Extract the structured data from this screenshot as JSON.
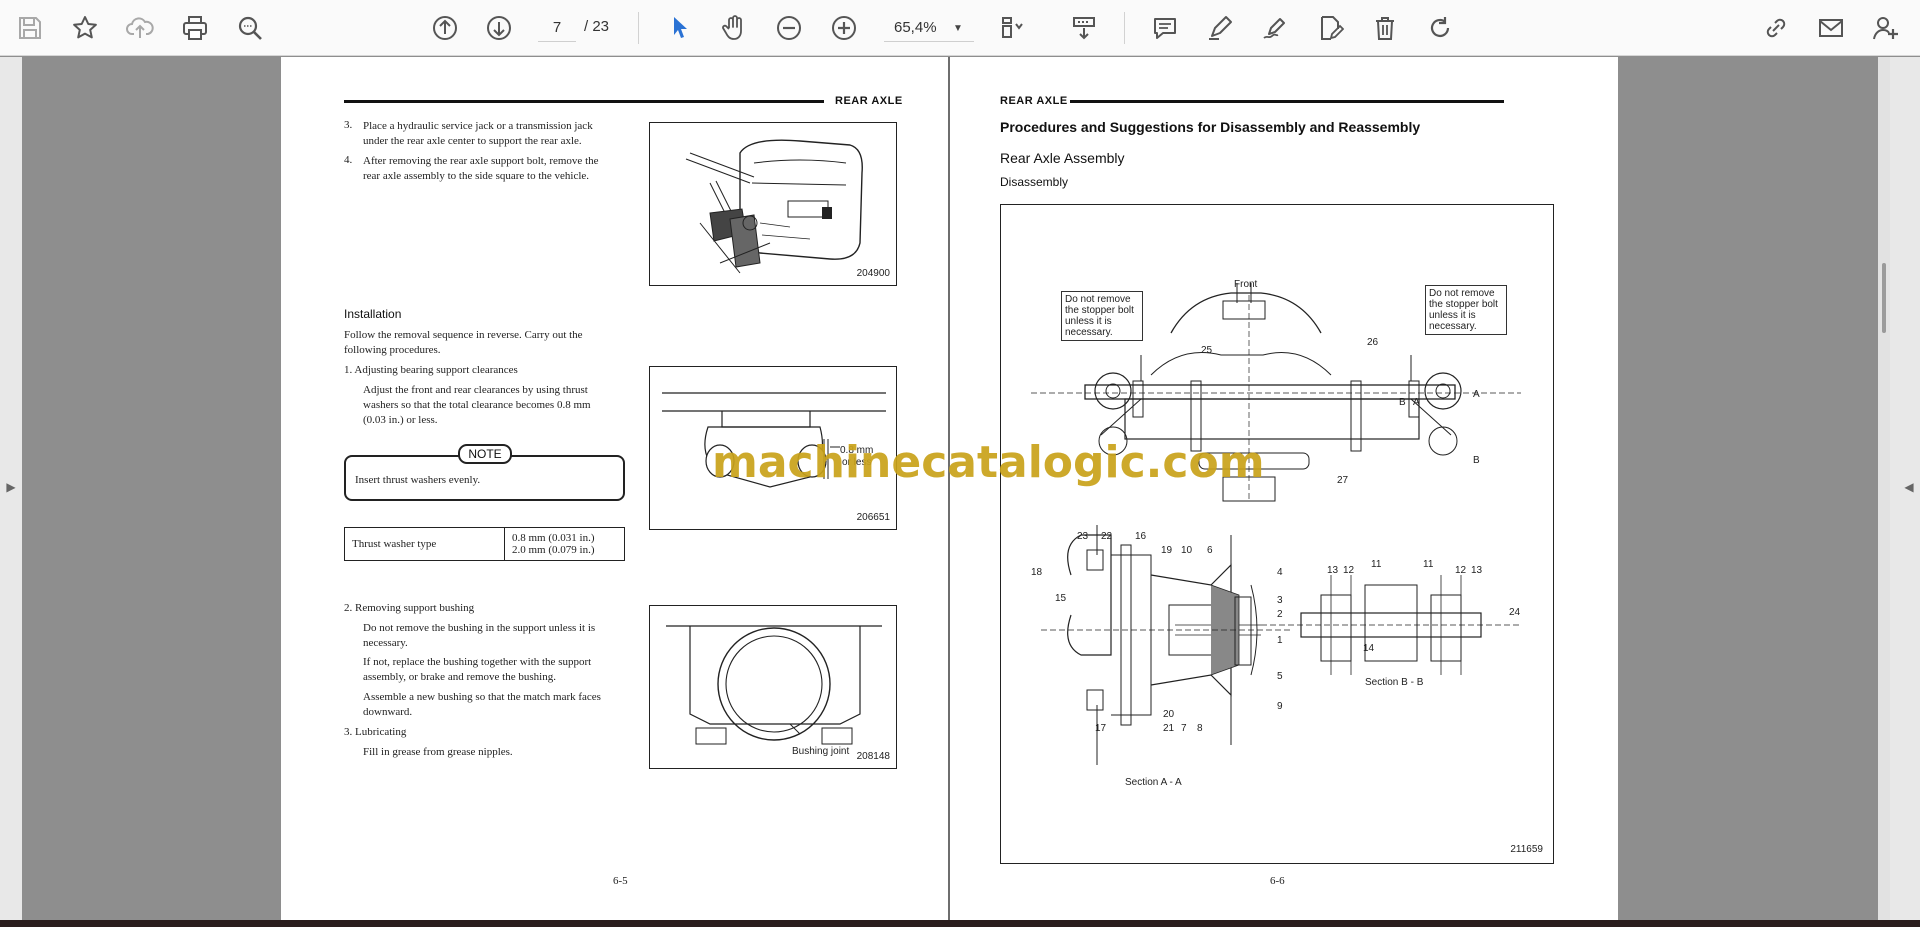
{
  "toolbar": {
    "current_page": "7",
    "page_total": "/ 23",
    "zoom": "65,4%"
  },
  "left_page": {
    "header": "REAR AXLE",
    "steps_top": [
      {
        "num": "3.",
        "lines": [
          "Place a hydraulic service jack or a transmission jack",
          "under the rear axle center to support the rear axle."
        ]
      },
      {
        "num": "4.",
        "lines": [
          "After removing the rear axle support bolt, remove the",
          "rear axle assembly to the side square to the vehicle."
        ]
      }
    ],
    "fig1_number": "204900",
    "install_heading": "Installation",
    "install_intro": [
      "Follow the removal sequence in reverse.  Carry out the",
      "following procedures."
    ],
    "step1_title": "1.   Adjusting bearing support clearances",
    "step1_body": [
      "Adjust the front and rear clearances by using thrust",
      "washers so that the total clearance becomes 0.8 mm",
      "(0.03 in.) or less."
    ],
    "note_label": "NOTE",
    "note_text": "Insert thrust washers evenly.",
    "table": {
      "label": "Thrust washer type",
      "values": [
        "0.8 mm (0.031 in.)",
        "2.0 mm (0.079 in.)"
      ]
    },
    "fig2_number": "206651",
    "fig2_label_a": "0.8 mm",
    "fig2_label_b": "or less",
    "step2_title": "2.   Removing support bushing",
    "step2_body": [
      [
        "Do not remove the bushing in the support unless it is",
        "necessary."
      ],
      [
        "If not, replace the bushing together with the support",
        "assembly, or brake and remove the bushing."
      ],
      [
        "Assemble a new bushing so that the match mark faces",
        "downward."
      ]
    ],
    "step3_title": "3.   Lubricating",
    "step3_body": "Fill in grease from grease nipples.",
    "fig3_number": "208148",
    "fig3_label": "Bushing joint",
    "page_number": "6-5"
  },
  "right_page": {
    "header": "REAR AXLE",
    "title": "Procedures and Suggestions for Disassembly and Reassembly",
    "subtitle": "Rear Axle Assembly",
    "sub2": "Disassembly",
    "diagram": {
      "front_label": "Front",
      "callout_left": [
        "Do not remove",
        "the stopper bolt",
        "unless it is",
        "necessary."
      ],
      "callout_right": [
        "Do not remove",
        "the stopper bolt",
        "unless it is",
        "necessary."
      ],
      "labels_top": [
        "25",
        "26",
        "A",
        "B",
        "A",
        "B",
        "27"
      ],
      "labels_section_a": [
        "23",
        "22",
        "16",
        "19",
        "10",
        "6",
        "18",
        "15",
        "4",
        "3",
        "2",
        "1",
        "5",
        "9",
        "17",
        "21",
        "20",
        "7",
        "8"
      ],
      "labels_section_b": [
        "13",
        "12",
        "11",
        "11",
        "12",
        "13",
        "24",
        "14"
      ],
      "section_a_caption": "Section A - A",
      "section_b_caption": "Section B - B",
      "fig_number": "211659"
    },
    "page_number": "6-6"
  },
  "watermark": "machinecatalogic.com"
}
